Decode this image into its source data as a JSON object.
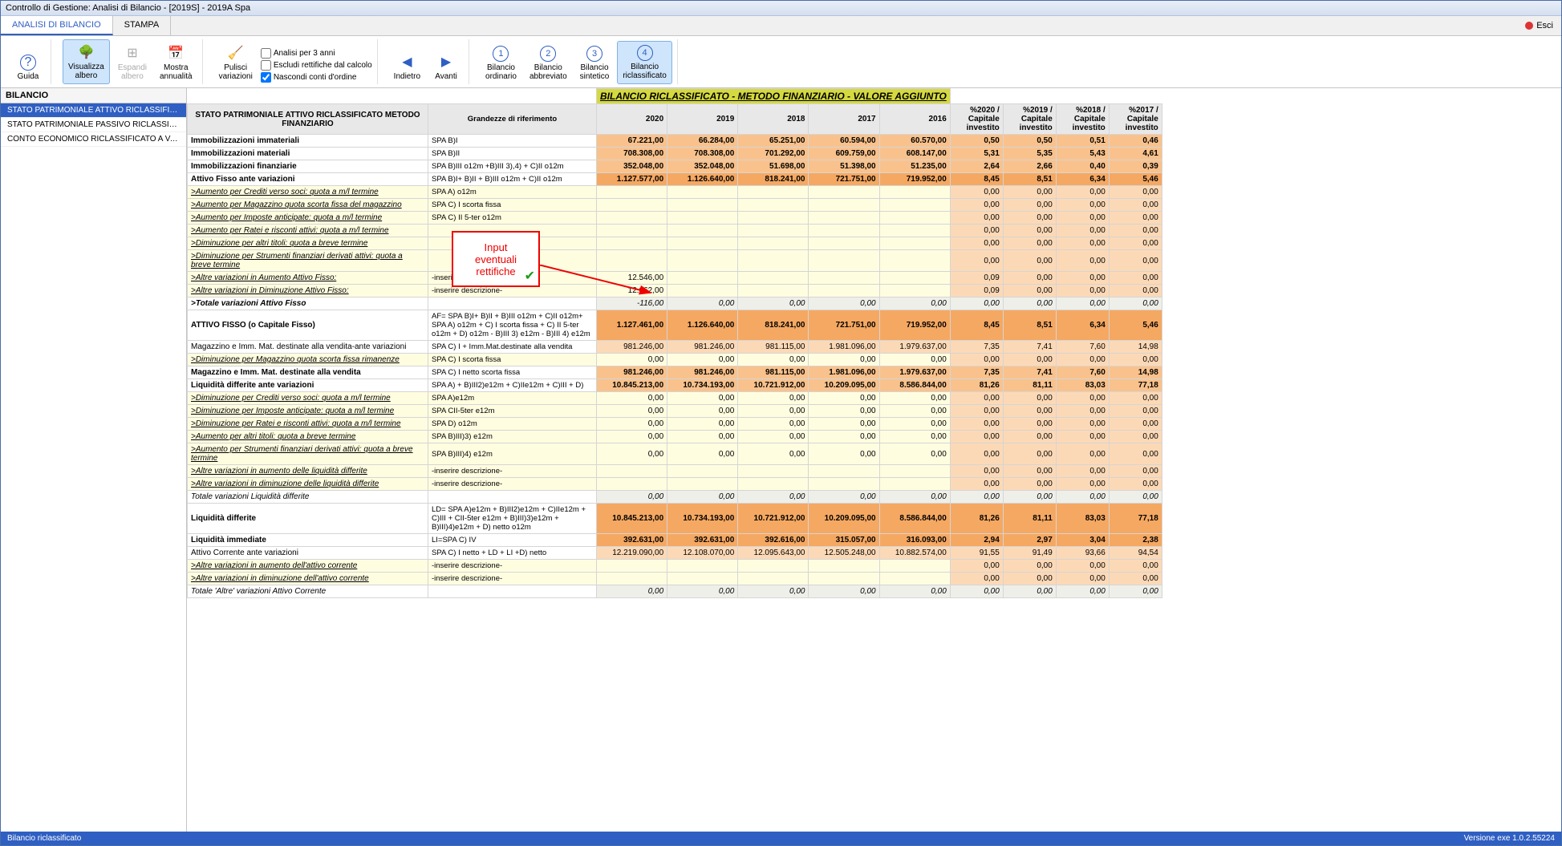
{
  "window_title": "Controllo di Gestione: Analisi di Bilancio - [2019S] - 2019A Spa",
  "tabs": {
    "t0": "ANALISI DI BILANCIO",
    "t1": "STAMPA",
    "exit": "Esci"
  },
  "ribbon": {
    "guida": "Guida",
    "vis_albero": "Visualizza\nalbero",
    "esp_albero": "Espandi\nalbero",
    "mostra_ann": "Mostra\nannualità",
    "pulisci": "Pulisci\nvariazioni",
    "chk_3anni": "Analisi per 3 anni",
    "chk_rett": "Escludi rettifiche dal calcolo",
    "chk_ord": "Nascondi conti d'ordine",
    "indietro": "Indietro",
    "avanti": "Avanti",
    "b1": "Bilancio\nordinario",
    "b2": "Bilancio\nabbreviato",
    "b3": "Bilancio\nsintetico",
    "b4": "Bilancio\nriclassificato"
  },
  "sidebar": {
    "head": "BILANCIO",
    "items": [
      "STATO PATRIMONIALE ATTIVO RICLASSIFICATO ME...",
      "STATO PATRIMONIALE PASSIVO RICLASSIFICATO M...",
      "CONTO ECONOMICO RICLASSIFICATO A VALORE ..."
    ]
  },
  "banner": "BILANCIO RICLASSIFICATO - METODO FINANZIARIO - VALORE AGGIUNTO",
  "headers": {
    "desc": "STATO PATRIMONIALE ATTIVO RICLASSIFICATO METODO FINANZIARIO",
    "ref": "Grandezze di riferimento",
    "y2020": "2020",
    "y2019": "2019",
    "y2018": "2018",
    "y2017": "2017",
    "y2016": "2016",
    "p2020": "%2020 /\nCapitale\ninvestito",
    "p2019": "%2019 /\nCapitale\ninvestito",
    "p2018": "%2018 /\nCapitale\ninvestito",
    "p2017": "%2017 /\nCapitale\ninvestito"
  },
  "callout": {
    "l1": "Input",
    "l2": "eventuali",
    "l3": "rettifiche"
  },
  "status": {
    "left": "Bilancio riclassificato",
    "right": "Versione exe 1.0.2.55224"
  },
  "rows": [
    {
      "d": "Immobilizzazioni immateriali",
      "r": "SPA B)I",
      "v": [
        "67.221,00",
        "66.284,00",
        "65.251,00",
        "60.594,00",
        "60.570,00"
      ],
      "p": [
        "0,50",
        "0,50",
        "0,51",
        "0,46"
      ],
      "s": "orb"
    },
    {
      "d": "Immobilizzazioni materiali",
      "r": "SPA B)II",
      "v": [
        "708.308,00",
        "708.308,00",
        "701.292,00",
        "609.759,00",
        "608.147,00"
      ],
      "p": [
        "5,31",
        "5,35",
        "5,43",
        "4,61"
      ],
      "s": "orb"
    },
    {
      "d": "Immobilizzazioni finanziarie",
      "r": "SPA B)III o12m +B)III 3),4) + C)II o12m",
      "v": [
        "352.048,00",
        "352.048,00",
        "51.698,00",
        "51.398,00",
        "51.235,00"
      ],
      "p": [
        "2,64",
        "2,66",
        "0,40",
        "0,39"
      ],
      "s": "orb"
    },
    {
      "d": "Attivo Fisso ante variazioni",
      "r": "SPA B)I+ B)II + B)III o12m + C)II o12m",
      "v": [
        "1.127.577,00",
        "1.126.640,00",
        "818.241,00",
        "721.751,00",
        "719.952,00"
      ],
      "p": [
        "8,45",
        "8,51",
        "6,34",
        "5,46"
      ],
      "s": "ord"
    },
    {
      "d": ">Aumento per Crediti verso soci: quota a m/l termine",
      "r": "SPA A) o12m",
      "v": [
        "",
        "",
        "",
        "",
        ""
      ],
      "p": [
        "0,00",
        "0,00",
        "0,00",
        "0,00"
      ],
      "s": "yl"
    },
    {
      "d": ">Aumento per Magazzino quota scorta fissa del magazzino",
      "r": "SPA C) I scorta fissa",
      "v": [
        "",
        "",
        "",
        "",
        ""
      ],
      "p": [
        "0,00",
        "0,00",
        "0,00",
        "0,00"
      ],
      "s": "yl"
    },
    {
      "d": ">Aumento per Imposte anticipate: quota a m/l termine",
      "r": "SPA C) II 5-ter o12m",
      "v": [
        "",
        "",
        "",
        "",
        ""
      ],
      "p": [
        "0,00",
        "0,00",
        "0,00",
        "0,00"
      ],
      "s": "yl"
    },
    {
      "d": ">Aumento per Ratei e risconti attivi: quota a m/l termine",
      "r": "",
      "v": [
        "",
        "",
        "",
        "",
        ""
      ],
      "p": [
        "0,00",
        "0,00",
        "0,00",
        "0,00"
      ],
      "s": "yl"
    },
    {
      "d": ">Diminuzione per altri titoli: quota a breve termine",
      "r": "",
      "v": [
        "",
        "",
        "",
        "",
        ""
      ],
      "p": [
        "0,00",
        "0,00",
        "0,00",
        "0,00"
      ],
      "s": "yl"
    },
    {
      "d": ">Diminuzione per Strumenti finanziari derivati attivi: quota a breve termine",
      "r": "",
      "v": [
        "",
        "",
        "",
        "",
        ""
      ],
      "p": [
        "0,00",
        "0,00",
        "0,00",
        "0,00"
      ],
      "s": "yl"
    },
    {
      "d": ">Altre variazioni in Aumento Attivo Fisso:",
      "r": "-inserire descrizione-",
      "v": [
        "12.546,00",
        "",
        "",
        "",
        ""
      ],
      "p": [
        "0,09",
        "0,00",
        "0,00",
        "0,00"
      ],
      "s": "yl"
    },
    {
      "d": ">Altre variazioni in Diminuzione Attivo Fisso:",
      "r": "-inserire descrizione-",
      "v": [
        "12.662,00",
        "",
        "",
        "",
        ""
      ],
      "p": [
        "0,09",
        "0,00",
        "0,00",
        "0,00"
      ],
      "s": "yl"
    },
    {
      "d": ">Totale variazioni Attivo Fisso",
      "r": "",
      "v": [
        "-116,00",
        "0,00",
        "0,00",
        "0,00",
        "0,00"
      ],
      "p": [
        "0,00",
        "0,00",
        "0,00",
        "0,00"
      ],
      "s": "grb"
    },
    {
      "d": "ATTIVO FISSO (o Capitale Fisso)",
      "r": "AF= SPA B)I+ B)II + B)III o12m + C)II o12m+ SPA A) o12m + C) I scorta fissa + C) II 5-ter o12m + D) o12m - B)III 3) e12m - B)III 4) e12m",
      "v": [
        "1.127.461,00",
        "1.126.640,00",
        "818.241,00",
        "721.751,00",
        "719.952,00"
      ],
      "p": [
        "8,45",
        "8,51",
        "6,34",
        "5,46"
      ],
      "s": "ord"
    },
    {
      "d": "Magazzino e Imm. Mat. destinate alla vendita-ante variazioni",
      "r": "SPA C) I + Imm.Mat.destinate alla vendita",
      "v": [
        "981.246,00",
        "981.246,00",
        "981.115,00",
        "1.981.096,00",
        "1.979.637,00"
      ],
      "p": [
        "7,35",
        "7,41",
        "7,60",
        "14,98"
      ],
      "s": "or"
    },
    {
      "d": ">Diminuzione per Magazzino quota scorta fissa rimanenze",
      "r": "SPA C) I scorta fissa",
      "v": [
        "0,00",
        "0,00",
        "0,00",
        "0,00",
        "0,00"
      ],
      "p": [
        "0,00",
        "0,00",
        "0,00",
        "0,00"
      ],
      "s": "yl"
    },
    {
      "d": "Magazzino e Imm. Mat. destinate alla vendita",
      "r": "SPA C) I netto scorta fissa",
      "v": [
        "981.246,00",
        "981.246,00",
        "981.115,00",
        "1.981.096,00",
        "1.979.637,00"
      ],
      "p": [
        "7,35",
        "7,41",
        "7,60",
        "14,98"
      ],
      "s": "orb"
    },
    {
      "d": "Liquidità differite ante variazioni",
      "r": "SPA A) + B)III2)e12m + C)IIe12m + C)III + D)",
      "v": [
        "10.845.213,00",
        "10.734.193,00",
        "10.721.912,00",
        "10.209.095,00",
        "8.586.844,00"
      ],
      "p": [
        "81,26",
        "81,11",
        "83,03",
        "77,18"
      ],
      "s": "orb"
    },
    {
      "d": ">Diminuzione per Crediti verso soci: quota a m/l termine",
      "r": "SPA A)e12m",
      "v": [
        "0,00",
        "0,00",
        "0,00",
        "0,00",
        "0,00"
      ],
      "p": [
        "0,00",
        "0,00",
        "0,00",
        "0,00"
      ],
      "s": "yl"
    },
    {
      "d": ">Diminuzione per Imposte anticipate: quota a m/l termine",
      "r": "SPA CII-5ter e12m",
      "v": [
        "0,00",
        "0,00",
        "0,00",
        "0,00",
        "0,00"
      ],
      "p": [
        "0,00",
        "0,00",
        "0,00",
        "0,00"
      ],
      "s": "yl"
    },
    {
      "d": ">Diminuzione per Ratei e risconti attivi: quota a m/l termine",
      "r": "SPA D) o12m",
      "v": [
        "0,00",
        "0,00",
        "0,00",
        "0,00",
        "0,00"
      ],
      "p": [
        "0,00",
        "0,00",
        "0,00",
        "0,00"
      ],
      "s": "yl"
    },
    {
      "d": ">Aumento per altri titoli: quota a breve termine",
      "r": "SPA B)III)3) e12m",
      "v": [
        "0,00",
        "0,00",
        "0,00",
        "0,00",
        "0,00"
      ],
      "p": [
        "0,00",
        "0,00",
        "0,00",
        "0,00"
      ],
      "s": "yl"
    },
    {
      "d": ">Aumento per Strumenti finanziari derivati attivi: quota a breve termine",
      "r": "SPA B)III)4) e12m",
      "v": [
        "0,00",
        "0,00",
        "0,00",
        "0,00",
        "0,00"
      ],
      "p": [
        "0,00",
        "0,00",
        "0,00",
        "0,00"
      ],
      "s": "yl"
    },
    {
      "d": ">Altre variazioni in aumento delle liquidità differite",
      "r": "-inserire descrizione-",
      "v": [
        "",
        "",
        "",
        "",
        ""
      ],
      "p": [
        "0,00",
        "0,00",
        "0,00",
        "0,00"
      ],
      "s": "yl"
    },
    {
      "d": ">Altre variazioni in diminuzione delle liquidità differite",
      "r": "-inserire descrizione-",
      "v": [
        "",
        "",
        "",
        "",
        ""
      ],
      "p": [
        "0,00",
        "0,00",
        "0,00",
        "0,00"
      ],
      "s": "yl"
    },
    {
      "d": "Totale variazioni Liquidità differite",
      "r": "",
      "v": [
        "0,00",
        "0,00",
        "0,00",
        "0,00",
        "0,00"
      ],
      "p": [
        "0,00",
        "0,00",
        "0,00",
        "0,00"
      ],
      "s": "gri"
    },
    {
      "d": "Liquidità differite",
      "r": "LD= SPA A)e12m + B)III2)e12m + C)IIe12m + C)III + CII-5ter e12m + B)III)3)e12m + B)III)4)e12m + D) netto o12m",
      "v": [
        "10.845.213,00",
        "10.734.193,00",
        "10.721.912,00",
        "10.209.095,00",
        "8.586.844,00"
      ],
      "p": [
        "81,26",
        "81,11",
        "83,03",
        "77,18"
      ],
      "s": "ord"
    },
    {
      "d": "Liquidità immediate",
      "r": "LI=SPA C) IV",
      "v": [
        "392.631,00",
        "392.631,00",
        "392.616,00",
        "315.057,00",
        "316.093,00"
      ],
      "p": [
        "2,94",
        "2,97",
        "3,04",
        "2,38"
      ],
      "s": "ord"
    },
    {
      "d": "Attivo Corrente ante variazioni",
      "r": "SPA C) I netto + LD + LI +D) netto",
      "v": [
        "12.219.090,00",
        "12.108.070,00",
        "12.095.643,00",
        "12.505.248,00",
        "10.882.574,00"
      ],
      "p": [
        "91,55",
        "91,49",
        "93,66",
        "94,54"
      ],
      "s": "or"
    },
    {
      "d": ">Altre variazioni in aumento dell'attivo corrente",
      "r": "-inserire descrizione-",
      "v": [
        "",
        "",
        "",
        "",
        ""
      ],
      "p": [
        "0,00",
        "0,00",
        "0,00",
        "0,00"
      ],
      "s": "yl"
    },
    {
      "d": ">Altre variazioni in diminuzione dell'attivo corrente",
      "r": "-inserire descrizione-",
      "v": [
        "",
        "",
        "",
        "",
        ""
      ],
      "p": [
        "0,00",
        "0,00",
        "0,00",
        "0,00"
      ],
      "s": "yl"
    },
    {
      "d": "Totale 'Altre' variazioni Attivo Corrente",
      "r": "",
      "v": [
        "0,00",
        "0,00",
        "0,00",
        "0,00",
        "0,00"
      ],
      "p": [
        "0,00",
        "0,00",
        "0,00",
        "0,00"
      ],
      "s": "gri"
    }
  ]
}
